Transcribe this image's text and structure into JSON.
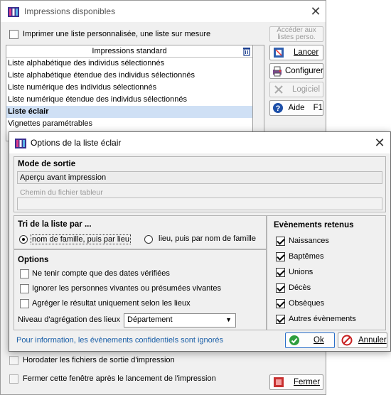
{
  "back_window": {
    "title": "Impressions disponibles",
    "custom_list_label": "Imprimer une liste personnalisée, une liste sur mesure",
    "access_lists_button": "Accéder aux listes perso.",
    "list_header": "Impressions standard",
    "items": [
      "Liste alphabétique des individus sélectionnés",
      "Liste alphabétique étendue des individus sélectionnés",
      "Liste numérique des individus sélectionnés",
      "Liste numérique étendue des individus sélectionnés",
      "Liste éclair",
      "Vignettes paramétrables"
    ],
    "selected_index": 4,
    "buttons": {
      "launch": "Lancer",
      "configure": "Configurer",
      "software": "Logiciel",
      "help": "Aide",
      "help_key": "F1",
      "close": "Fermer"
    },
    "timestamp_label": "Horodater les fichiers de sortie d'impression",
    "close_after_label": "Fermer cette fenêtre après le lancement de l'impression"
  },
  "dialog": {
    "title": "Options de la liste éclair",
    "output_mode": {
      "title": "Mode de sortie",
      "value": "Aperçu avant impression",
      "spreadsheet_label": "Chemin du fichier tableur",
      "spreadsheet_value": ""
    },
    "sort": {
      "title": "Tri de la liste par ...",
      "option1": "nom de famille, puis par lieu",
      "option2": "lieu, puis par nom de famille",
      "selected": 1
    },
    "options": {
      "title": "Options",
      "checks": [
        {
          "label": "Ne tenir compte que des dates vérifiées",
          "checked": false
        },
        {
          "label": "Ignorer les personnes vivantes ou présumées vivantes",
          "checked": false
        },
        {
          "label": "Agréger le résultat uniquement selon les lieux",
          "checked": false
        }
      ],
      "aggregation_label": "Niveau d'agrégation des lieux",
      "aggregation_value": "Département"
    },
    "events": {
      "title": "Evènements retenus",
      "items": [
        {
          "label": "Naissances",
          "checked": true
        },
        {
          "label": "Baptêmes",
          "checked": true
        },
        {
          "label": "Unions",
          "checked": true
        },
        {
          "label": "Décès",
          "checked": true
        },
        {
          "label": "Obsèques",
          "checked": true
        },
        {
          "label": "Autres évènements",
          "checked": true
        }
      ]
    },
    "info": "Pour information, les évènements confidentiels sont ignorés",
    "ok": "Ok",
    "cancel": "Annuler"
  },
  "colors": {
    "selection": "#cfe0f5",
    "info_text": "#1a5fa8",
    "ok_border": "#2a6fc9"
  }
}
